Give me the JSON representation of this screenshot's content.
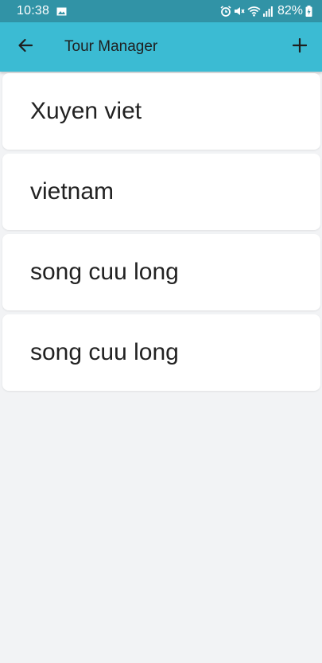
{
  "status_bar": {
    "time": "10:38",
    "battery": "82%",
    "icons": [
      "gallery-icon",
      "alarm-icon",
      "mute-icon",
      "wifi-icon",
      "signal-icon",
      "battery-charging-icon"
    ]
  },
  "app_bar": {
    "title": "Tour Manager",
    "back_icon": "arrow-left-icon",
    "add_icon": "plus-icon",
    "background": "#3bbbd3"
  },
  "tours": [
    {
      "name": "Xuyen viet"
    },
    {
      "name": "vietnam"
    },
    {
      "name": "song cuu long"
    },
    {
      "name": "song cuu long"
    }
  ],
  "colors": {
    "status_bar": "#3193a6",
    "page_background": "#f2f3f5",
    "card": "#ffffff"
  }
}
